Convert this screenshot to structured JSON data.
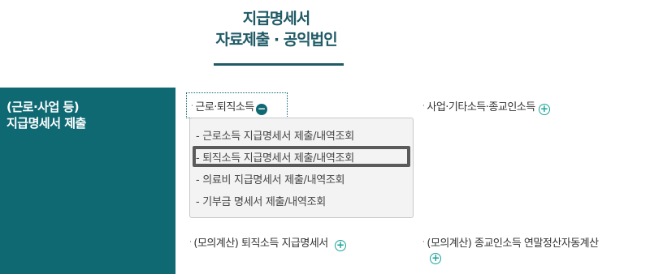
{
  "header": {
    "line1": "지급명세서",
    "line2": "자료제출 · 공익법인"
  },
  "sidebar": {
    "title_line1": "(근로·사업 등)",
    "title_line2": "지급명세서 제출"
  },
  "menu": {
    "labor_retirement": "근로·퇴직소득",
    "business_other": "사업·기타소득·종교인소득",
    "mock_retirement": "(모의계산) 퇴직소득 지급명세서",
    "mock_religious": "(모의계산) 종교인소득 연말정산자동계산",
    "bullet": "·",
    "plus_icon": "+",
    "minus_icon": "−"
  },
  "submenu": {
    "items": [
      "- 근로소득 지급명세서 제출/내역조회",
      "- 퇴직소득 지급명세서 제출/내역조회",
      "- 의료비 지급명세서 제출/내역조회",
      "- 기부금 명세서 제출/내역조회"
    ]
  },
  "colors": {
    "primary": "#0f6973",
    "accent": "#1aa39a"
  }
}
